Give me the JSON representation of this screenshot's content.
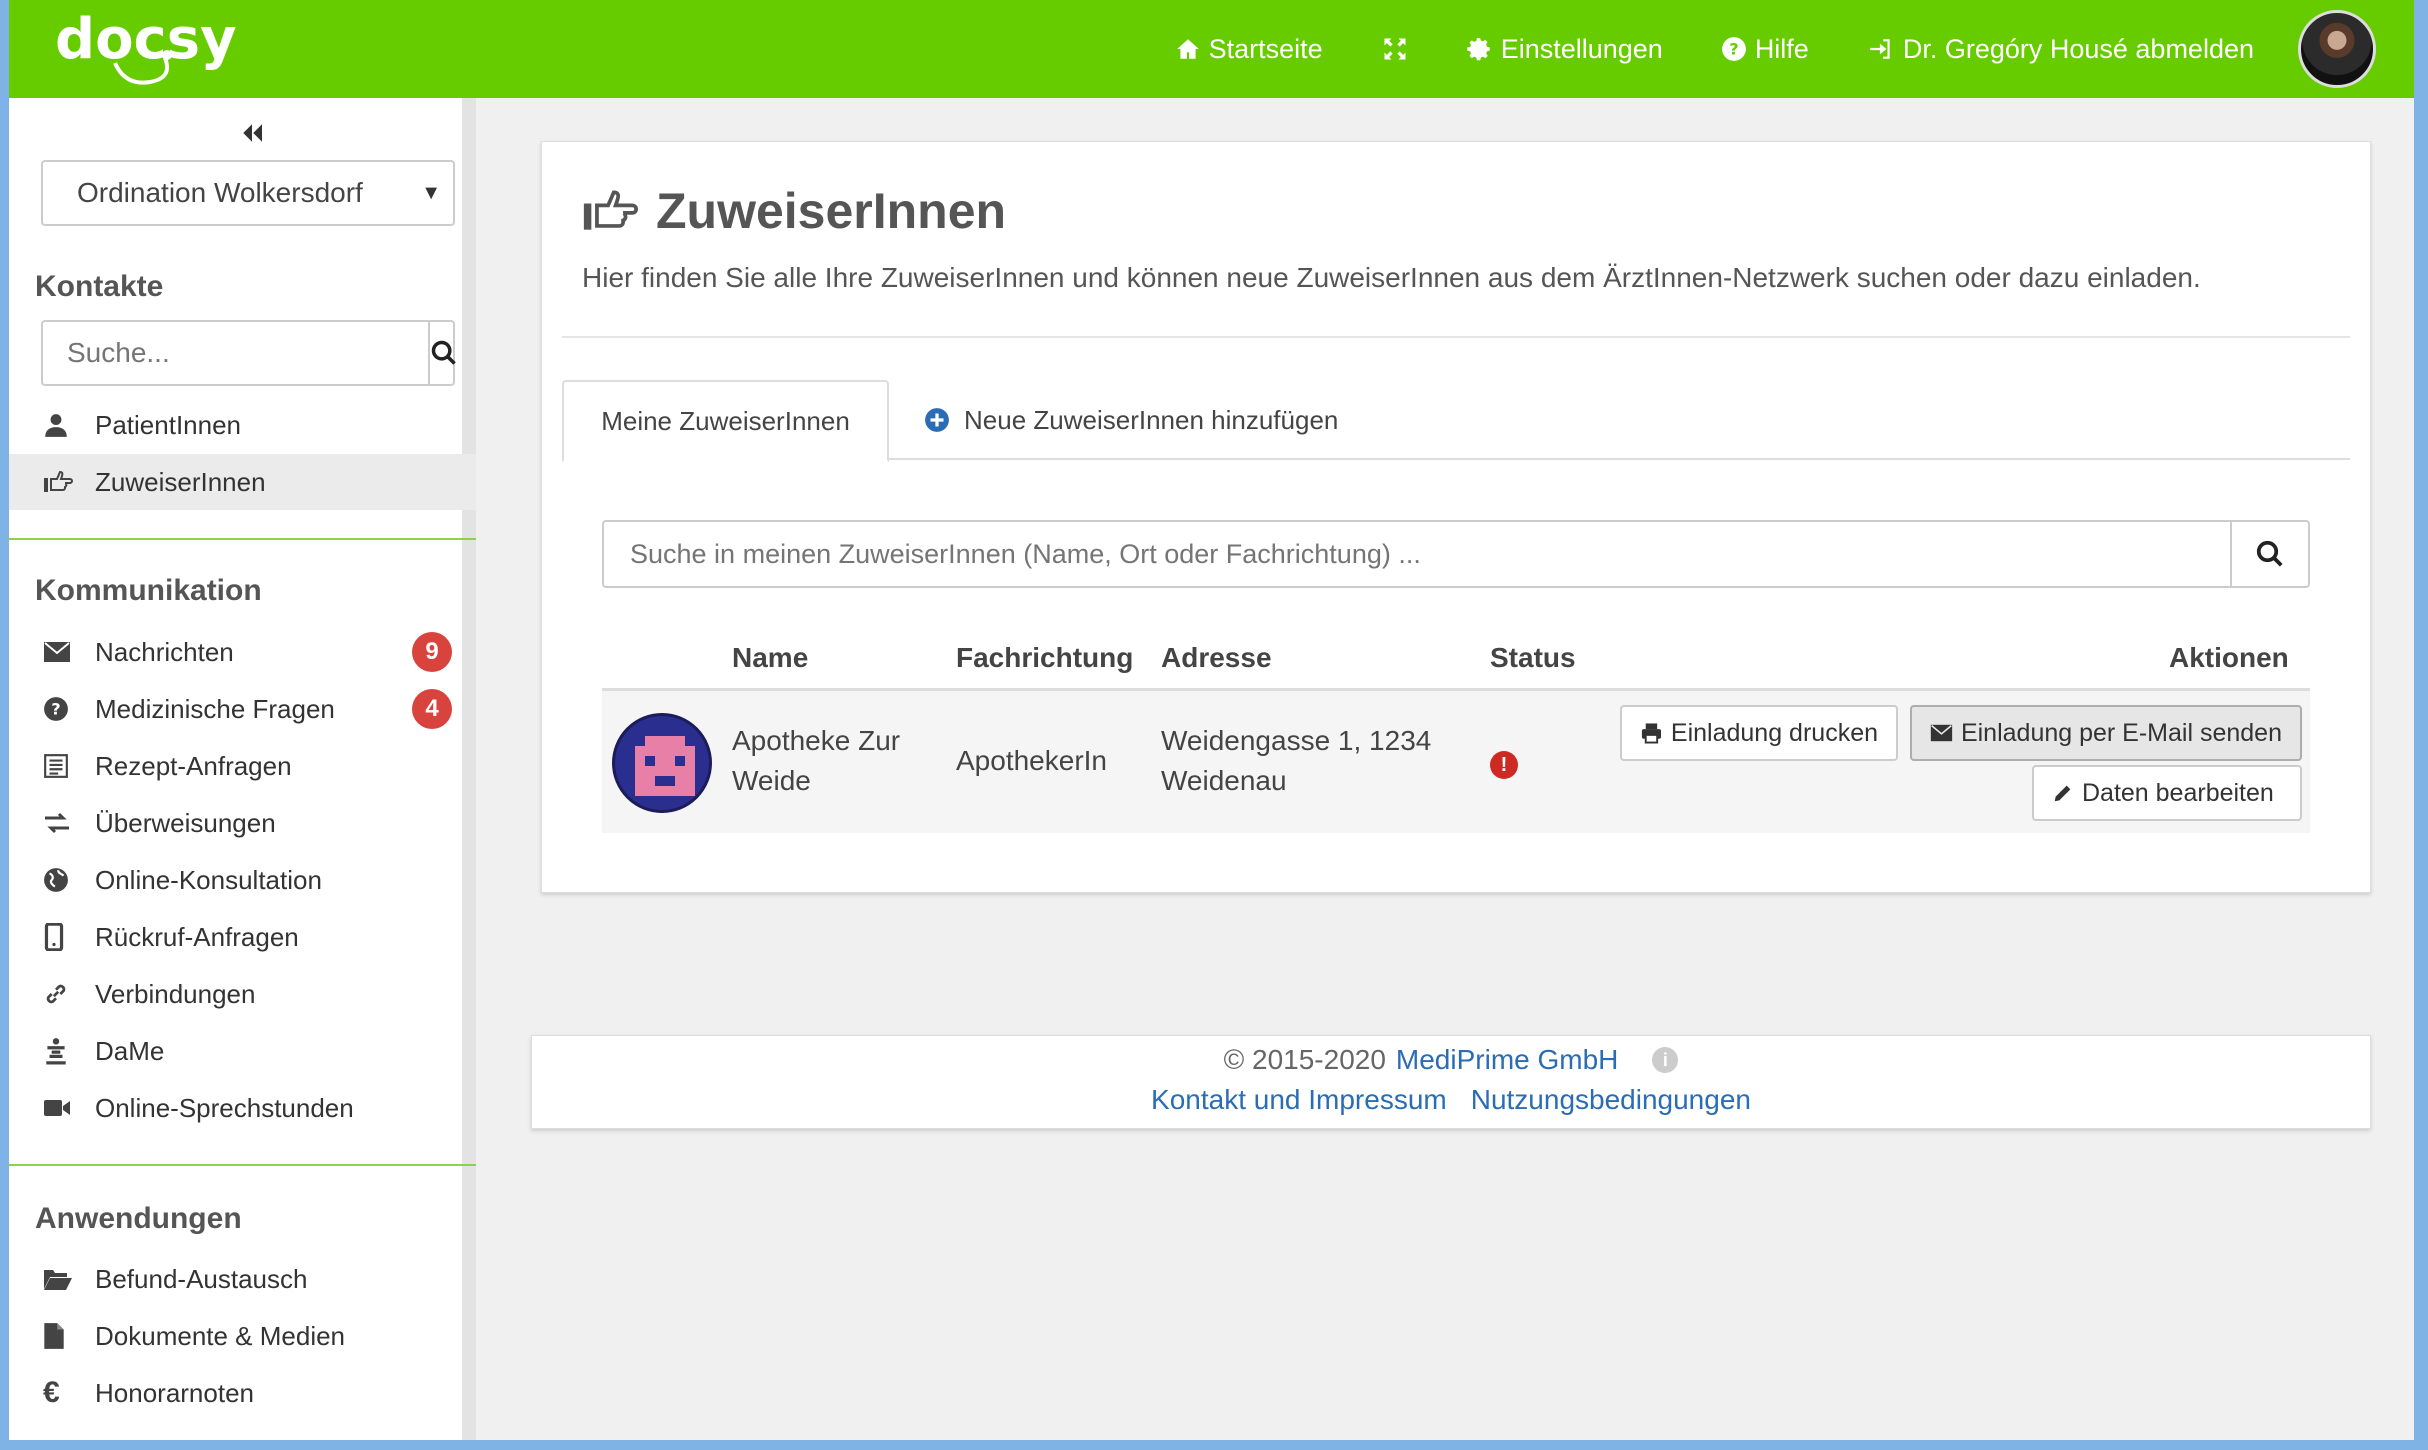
{
  "app": {
    "logo": "docsy",
    "brand_color": "#66cc00"
  },
  "topnav": {
    "home": "Startseite",
    "settings": "Einstellungen",
    "help": "Hilfe",
    "logout": "Dr. Gregóry Housé abmelden"
  },
  "sidebar": {
    "practice": "Ordination Wolkersdorf",
    "contacts_title": "Kontakte",
    "search_placeholder": "Suche...",
    "contacts": [
      {
        "label": "PatientInnen",
        "icon": "user-icon"
      },
      {
        "label": "ZuweiserInnen",
        "icon": "hand-point-icon",
        "active": true
      }
    ],
    "communication_title": "Kommunikation",
    "communication": [
      {
        "label": "Nachrichten",
        "icon": "envelope-icon",
        "badge": "9"
      },
      {
        "label": "Medizinische Fragen",
        "icon": "question-icon",
        "badge": "4"
      },
      {
        "label": "Rezept-Anfragen",
        "icon": "list-icon"
      },
      {
        "label": "Überweisungen",
        "icon": "transfer-icon"
      },
      {
        "label": "Online-Konsultation",
        "icon": "globe-icon"
      },
      {
        "label": "Rückruf-Anfragen",
        "icon": "phone-icon"
      },
      {
        "label": "Verbindungen",
        "icon": "link-icon"
      },
      {
        "label": "DaMe",
        "icon": "dame-icon"
      },
      {
        "label": "Online-Sprechstunden",
        "icon": "video-icon"
      }
    ],
    "applications_title": "Anwendungen",
    "applications": [
      {
        "label": "Befund-Austausch",
        "icon": "folder-open-icon"
      },
      {
        "label": "Dokumente & Medien",
        "icon": "file-icon"
      },
      {
        "label": "Honorarnoten",
        "icon": "euro-icon"
      }
    ]
  },
  "main": {
    "title": "ZuweiserInnen",
    "subtitle": "Hier finden Sie alle Ihre ZuweiserInnen und können neue ZuweiserInnen aus dem ÄrztInnen-Netzwerk suchen oder dazu einladen.",
    "tabs": [
      "Meine ZuweiserInnen",
      "Neue ZuweiserInnen hinzufügen"
    ],
    "search_placeholder": "Suche in meinen ZuweiserInnen (Name, Ort oder Fachrichtung) ...",
    "columns": [
      "Name",
      "Fachrichtung",
      "Adresse",
      "Status",
      "Aktionen"
    ],
    "rows": [
      {
        "name_line1": "Apotheke Zur",
        "name_line2": "Weide",
        "specialty": "ApothekerIn",
        "address_line1": "Weidengasse 1, 1234",
        "address_line2": "Weidenau",
        "status": "!",
        "actions": [
          "Einladung drucken",
          "Einladung per E-Mail senden",
          "Daten bearbeiten"
        ]
      }
    ]
  },
  "footer": {
    "copyright": "© 2015-2020",
    "company": "MediPrime GmbH",
    "links": [
      "Kontakt und Impressum",
      "Nutzungsbedingungen"
    ]
  }
}
